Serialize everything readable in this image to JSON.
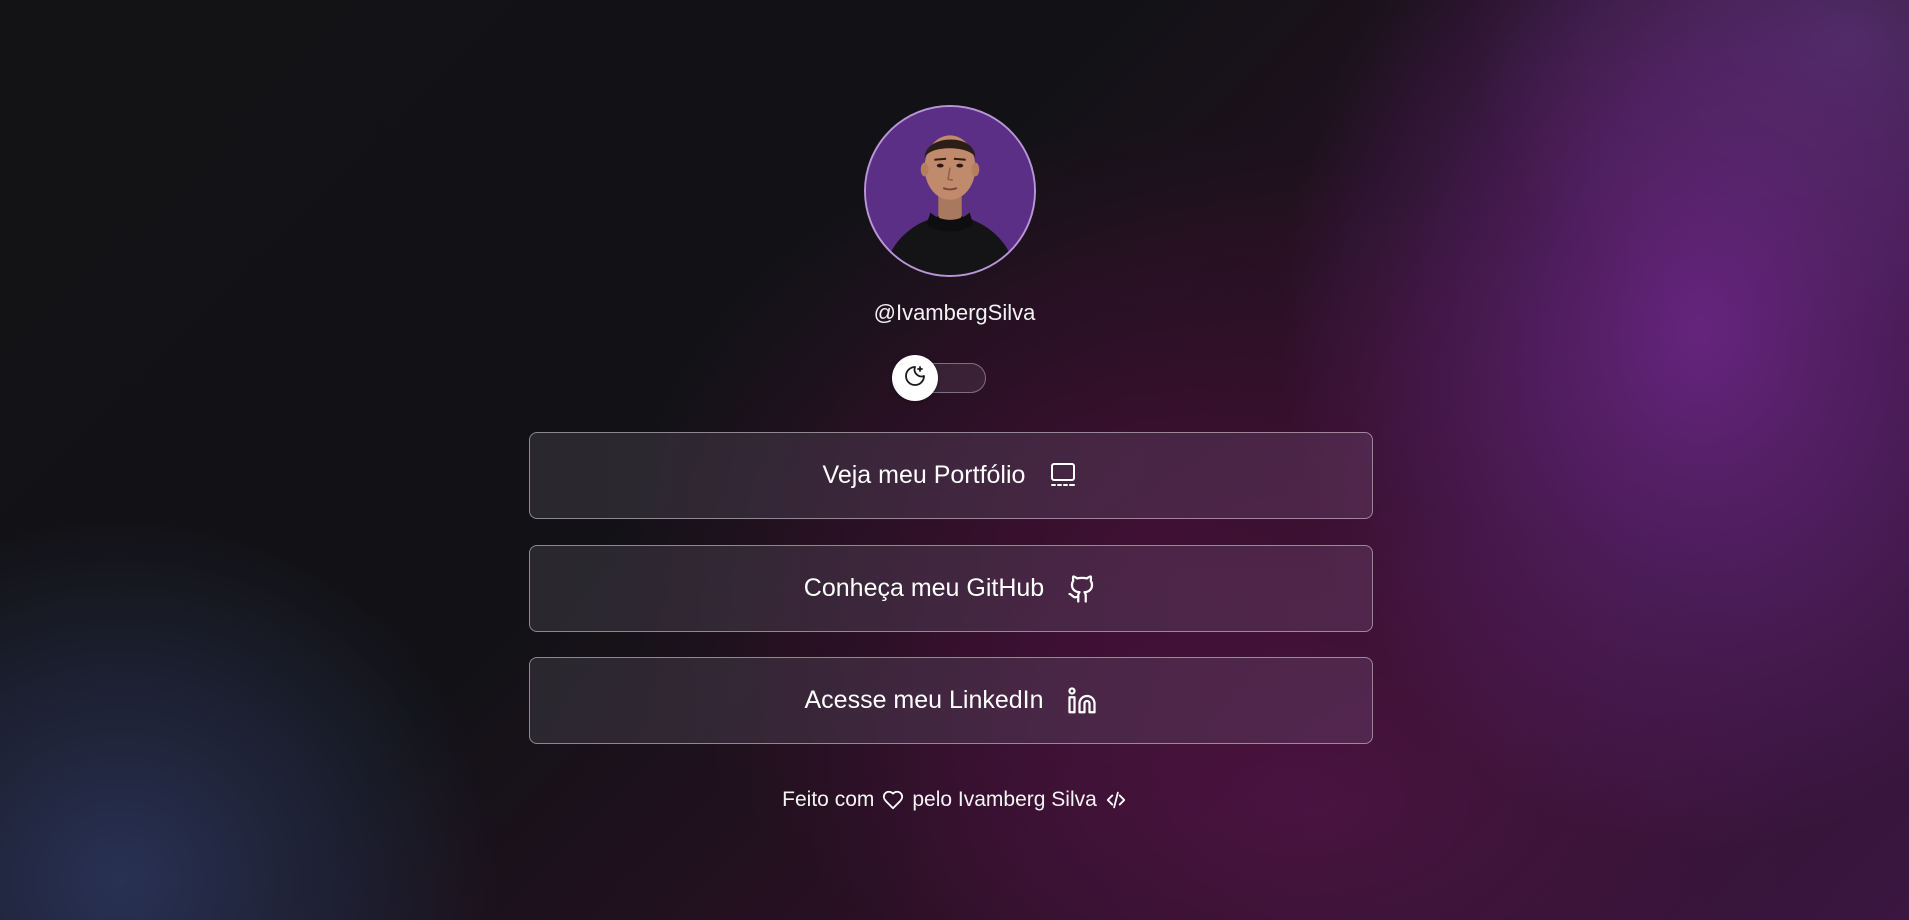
{
  "profile": {
    "avatar_icon": "profile-photo",
    "username": "@IvambergSilva"
  },
  "theme_toggle": {
    "icon": "moon-sparkle-icon",
    "state": "dark"
  },
  "links": [
    {
      "label": "Veja meu Portfólio",
      "icon": "presentation-icon"
    },
    {
      "label": "Conheça meu GitHub",
      "icon": "github-icon"
    },
    {
      "label": "Acesse meu LinkedIn",
      "icon": "linkedin-icon"
    }
  ],
  "footer": {
    "text_before": "Feito com",
    "text_after": "pelo Ivamberg Silva",
    "heart_icon": "heart-icon",
    "code_icon": "code-icon"
  },
  "colors": {
    "avatar_bg": "#5b2f86",
    "avatar_border": "#b896d6",
    "accent_purple": "#6e288c",
    "text": "#ffffff"
  }
}
